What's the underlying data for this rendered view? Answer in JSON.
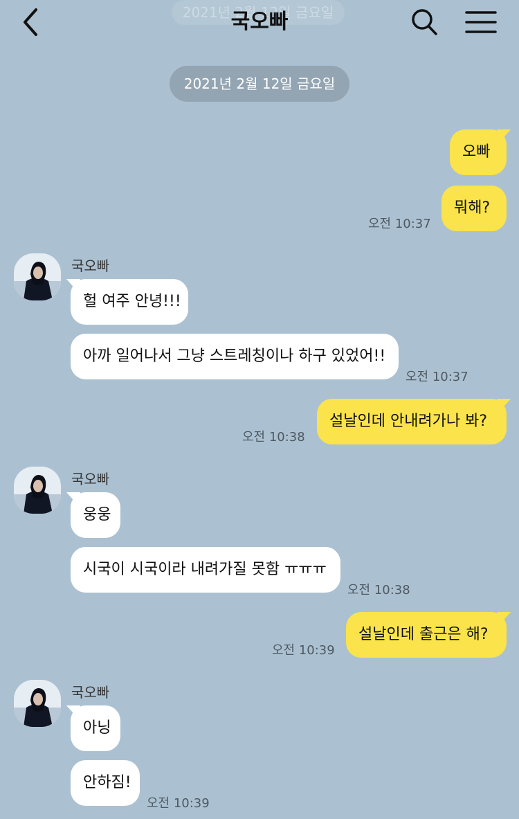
{
  "header": {
    "title": "국오빠",
    "ghost_date": "2021년 2월 12일 금요일",
    "back_icon": "chevron-left-icon",
    "search_icon": "search-icon",
    "menu_icon": "hamburger-menu-icon"
  },
  "date_divider": "2021년 2월 12일 금요일",
  "colors": {
    "background": "#abc1d1",
    "my_bubble": "#fae34b",
    "other_bubble": "#ffffff",
    "date_pill": "#93a4b2"
  },
  "messages": {
    "m1": {
      "text": "오빠"
    },
    "m2": {
      "text": "뭐해?",
      "time": "오전 10:37"
    },
    "g1": {
      "sender": "국오빠",
      "m1": {
        "text": "헐 여주 안녕!!!"
      },
      "m2": {
        "text": "아까 일어나서 그냥 스트레칭이나 하구 있었어!!",
        "time": "오전 10:37"
      }
    },
    "m3": {
      "text": "설날인데 안내려가나 봐?",
      "time": "오전 10:38"
    },
    "g2": {
      "sender": "국오빠",
      "m1": {
        "text": "웅웅"
      },
      "m2": {
        "text": "시국이 시국이라 내려가질 못함 ㅠㅠㅠ",
        "time": "오전 10:38"
      }
    },
    "m4": {
      "text": "설날인데 출근은 해?",
      "time": "오전 10:39"
    },
    "g3": {
      "sender": "국오빠",
      "m1": {
        "text": "아닝"
      },
      "m2": {
        "text": "안하짐!",
        "time": "오전 10:39"
      }
    }
  }
}
